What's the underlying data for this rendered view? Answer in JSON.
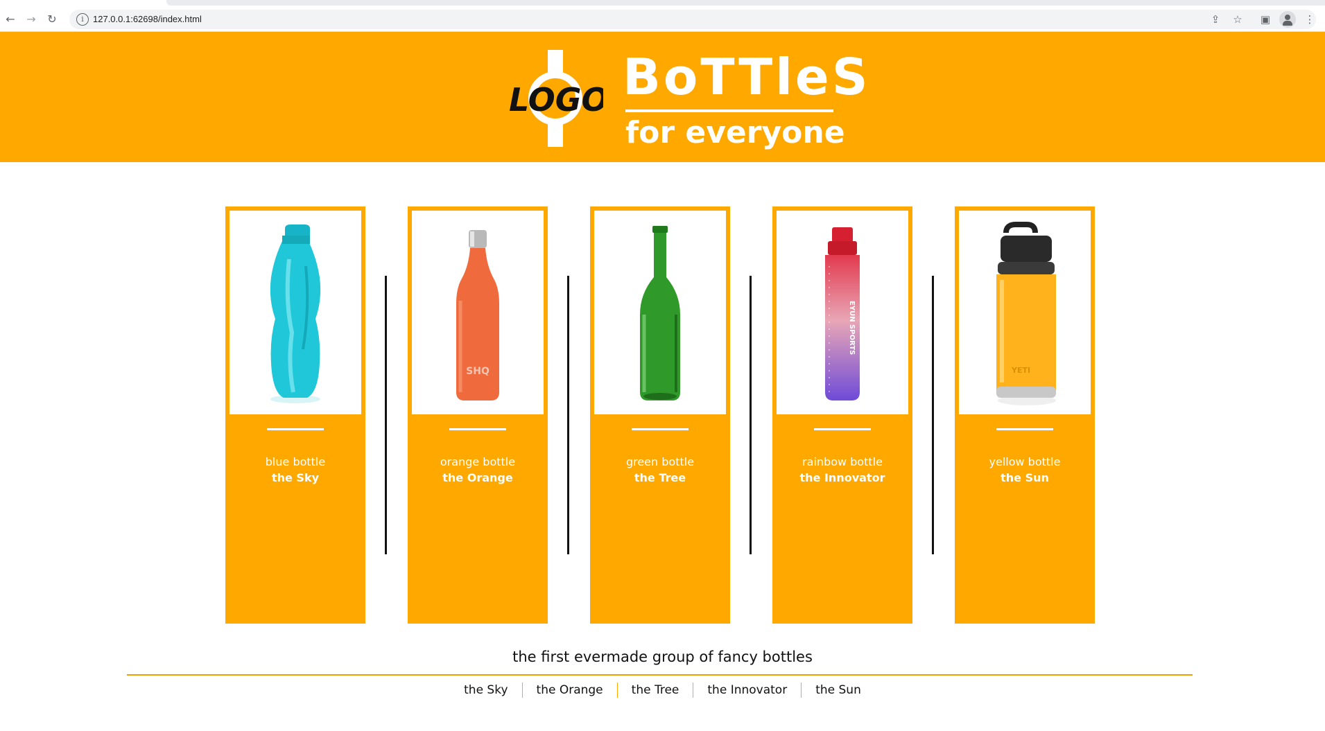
{
  "browser": {
    "url": "127.0.0.1:62698/index.html"
  },
  "header": {
    "logo_text": "LOGO",
    "brand_title": "BoTTleS",
    "brand_subtitle": "for everyone",
    "background_color": "#fea800"
  },
  "products": [
    {
      "name": "blue bottle",
      "nickname": "the Sky",
      "bottle_color": "#1fc7d9",
      "icon": "blue-bottle-image"
    },
    {
      "name": "orange bottle",
      "nickname": "the Orange",
      "bottle_color": "#ef6a3c",
      "icon": "orange-bottle-image",
      "print": "SHQ"
    },
    {
      "name": "green bottle",
      "nickname": "the Tree",
      "bottle_color": "#2f9a2a",
      "icon": "green-bottle-image"
    },
    {
      "name": "rainbow bottle",
      "nickname": "the Innovator",
      "bottle_color": "#e04a6a",
      "icon": "rainbow-bottle-image",
      "print": "EYUN SPORTS"
    },
    {
      "name": "yellow bottle",
      "nickname": "the Sun",
      "bottle_color": "#ffb21c",
      "icon": "yellow-bottle-image",
      "print": "YETI"
    }
  ],
  "footer": {
    "tagline": "the first evermade group of fancy bottles",
    "links": [
      "the Sky",
      "the Orange",
      "the Tree",
      "the Innovator",
      "the Sun"
    ],
    "accent_color": "#e9a000"
  }
}
